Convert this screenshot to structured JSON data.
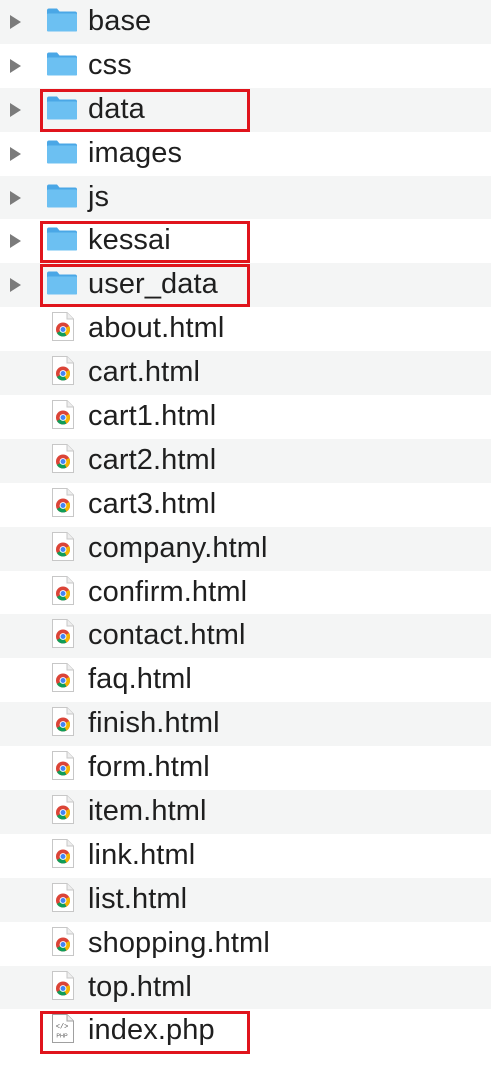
{
  "files": [
    {
      "name": "base",
      "type": "folder",
      "highlighted": false
    },
    {
      "name": "css",
      "type": "folder",
      "highlighted": false
    },
    {
      "name": "data",
      "type": "folder",
      "highlighted": true
    },
    {
      "name": "images",
      "type": "folder",
      "highlighted": false
    },
    {
      "name": "js",
      "type": "folder",
      "highlighted": false
    },
    {
      "name": "kessai",
      "type": "folder",
      "highlighted": true
    },
    {
      "name": "user_data",
      "type": "folder",
      "highlighted": true
    },
    {
      "name": "about.html",
      "type": "html",
      "highlighted": false
    },
    {
      "name": "cart.html",
      "type": "html",
      "highlighted": false
    },
    {
      "name": "cart1.html",
      "type": "html",
      "highlighted": false
    },
    {
      "name": "cart2.html",
      "type": "html",
      "highlighted": false
    },
    {
      "name": "cart3.html",
      "type": "html",
      "highlighted": false
    },
    {
      "name": "company.html",
      "type": "html",
      "highlighted": false
    },
    {
      "name": "confirm.html",
      "type": "html",
      "highlighted": false
    },
    {
      "name": "contact.html",
      "type": "html",
      "highlighted": false
    },
    {
      "name": "faq.html",
      "type": "html",
      "highlighted": false
    },
    {
      "name": "finish.html",
      "type": "html",
      "highlighted": false
    },
    {
      "name": "form.html",
      "type": "html",
      "highlighted": false
    },
    {
      "name": "item.html",
      "type": "html",
      "highlighted": false
    },
    {
      "name": "link.html",
      "type": "html",
      "highlighted": false
    },
    {
      "name": "list.html",
      "type": "html",
      "highlighted": false
    },
    {
      "name": "shopping.html",
      "type": "html",
      "highlighted": false
    },
    {
      "name": "top.html",
      "type": "html",
      "highlighted": false
    },
    {
      "name": "index.php",
      "type": "php",
      "highlighted": true
    }
  ],
  "icons": {
    "folder": "folder-icon",
    "html": "chrome-html-file-icon",
    "php": "php-file-icon"
  },
  "colors": {
    "highlight": "#e0141c",
    "folder": "#5fb3ea",
    "row_alt": "#f4f5f5",
    "disclosure": "#7b7b7b"
  },
  "php_icon_label": "PHP"
}
